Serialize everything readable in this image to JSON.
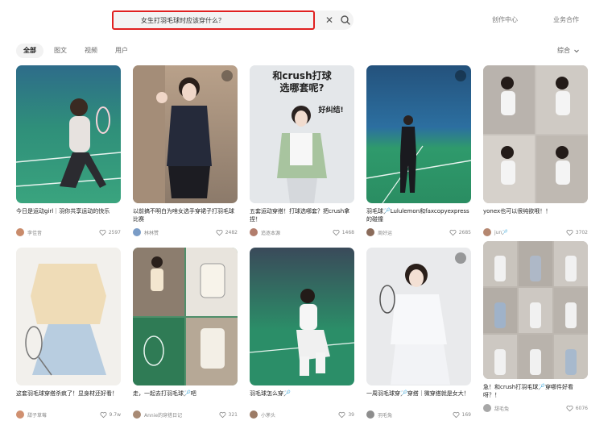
{
  "search": {
    "query": "女生打羽毛球时应该穿什么？"
  },
  "header": {
    "creator_center": "创作中心",
    "business": "业务合作"
  },
  "tabs": [
    {
      "label": "全部",
      "active": true
    },
    {
      "label": "图文",
      "active": false
    },
    {
      "label": "视频",
      "active": false
    },
    {
      "label": "用户",
      "active": false
    }
  ],
  "sort": {
    "label": "综合"
  },
  "cards": [
    {
      "title": "今日是运动girl｜羽你共享运动的快乐",
      "author": "李佳音",
      "likes": "2597",
      "bg": "#3aa47e",
      "avatar": "#c98b6b"
    },
    {
      "title": "以前搞不明白为啥女选手穿裙子打羽毛球比赛",
      "author": "林林赞",
      "likes": "2482",
      "bg": "#8c7a6a",
      "avatar": "#7a9cc6"
    },
    {
      "title": "五套运动穿搭！打球选哪套？把crush拿捏！",
      "author": "追逐本源",
      "likes": "1468",
      "bg": "#dfe3e6",
      "avatar": "#b27d6c",
      "overlay1": "和crush打球",
      "overlay2": "选哪套呢?",
      "overlay3": "好纠结!"
    },
    {
      "title": "羽毛球🏸Lululemon和faxcopyexpress的碰撞",
      "author": "周好运",
      "likes": "2685",
      "bg": "#2c6fa0",
      "avatar": "#8a6b5a"
    },
    {
      "title": "yonex也可以很纯欲哦！！",
      "author": "jun🏸",
      "likes": "3702",
      "bg": "#c7c2bc",
      "avatar": "#b58770"
    },
    {
      "title": "这套羽毛球穿搭杀疯了！显身材还好看！",
      "author": "甜子草莓",
      "likes": "9.7w",
      "bg": "#f2f0ec",
      "avatar": "#d09070"
    },
    {
      "title": "走，一起去打羽毛球🏸吧",
      "author": "Annie的穿搭日记",
      "likes": "321",
      "bg": "#4f8f6a",
      "avatar": "#a88a74"
    },
    {
      "title": "羽毛球怎么穿🏸",
      "author": "小茅头",
      "likes": "39",
      "bg": "#2b8e68",
      "avatar": "#9c7b66"
    },
    {
      "title": "一周羽毛球穿🏸穿搭｜微穿搭就是女大！",
      "author": "羽毛兔",
      "likes": "169",
      "bg": "#e9eaec",
      "avatar": "#8d8d8d"
    },
    {
      "title": "急！和crush打羽毛球🏸穿哪件好看呀？！",
      "author": "甜毛兔",
      "likes": "6076",
      "bg": "#bdb7b0",
      "avatar": "#a7a7a7"
    }
  ],
  "colors": {
    "search_border": "#e02020",
    "accent_text": "#222222"
  }
}
